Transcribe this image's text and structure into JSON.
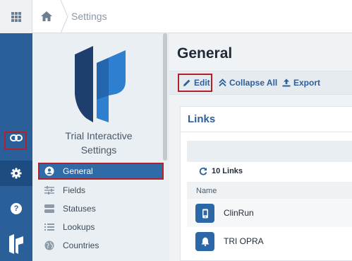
{
  "breadcrumb": {
    "current": "Settings"
  },
  "sidebar": {
    "title_line1": "Trial Interactive",
    "title_line2": "Settings",
    "items": [
      {
        "label": "General",
        "icon": "user-circle-icon"
      },
      {
        "label": "Fields",
        "icon": "sliders-icon"
      },
      {
        "label": "Statuses",
        "icon": "toggle-icon"
      },
      {
        "label": "Lookups",
        "icon": "list-icon"
      },
      {
        "label": "Countries",
        "icon": "globe-icon"
      }
    ]
  },
  "main": {
    "title": "General",
    "toolbar": {
      "edit_label": "Edit",
      "collapse_label": "Collapse All",
      "export_label": "Export"
    },
    "card": {
      "title": "Links",
      "count_label": "10 Links",
      "column_name": "Name",
      "rows": [
        {
          "label": "ClinRun",
          "icon": "mobile-icon"
        },
        {
          "label": "TRI OPRA",
          "icon": "bell-icon"
        }
      ]
    }
  },
  "colors": {
    "rail": "#2a5f99",
    "accent": "#2d5f98",
    "highlight": "#b2202a",
    "sidebar": "#e9eff3"
  }
}
